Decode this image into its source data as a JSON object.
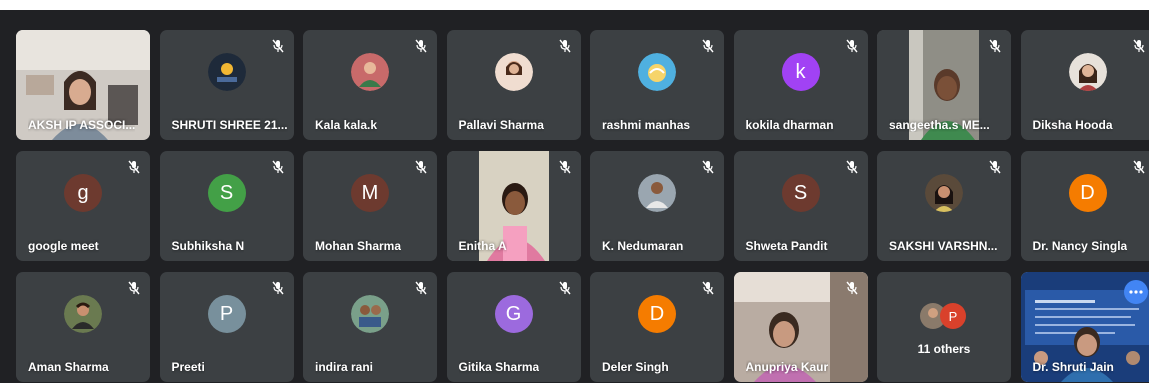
{
  "colors": {
    "tile": "#3c4043",
    "background": "#202124",
    "active_outline": "#8ab4f8"
  },
  "participants": [
    {
      "name": "AKSH IP ASSOCI...",
      "type": "video",
      "muted": false
    },
    {
      "name": "SHRUTI SHREE 21...",
      "type": "photo",
      "muted": true
    },
    {
      "name": "Kala kala.k",
      "type": "photo",
      "muted": true
    },
    {
      "name": "Pallavi Sharma",
      "type": "photo",
      "muted": true
    },
    {
      "name": "rashmi manhas",
      "type": "photo",
      "muted": true
    },
    {
      "name": "kokila dharman",
      "type": "initial",
      "initial": "k",
      "color": "#a142f4",
      "muted": true
    },
    {
      "name": "sangeetha.s ME...",
      "type": "video",
      "muted": true
    },
    {
      "name": "Diksha Hooda",
      "type": "photo",
      "muted": true
    },
    {
      "name": "google meet",
      "type": "initial",
      "initial": "g",
      "color": "#6d3a2f",
      "muted": true
    },
    {
      "name": "Subhiksha N",
      "type": "initial",
      "initial": "S",
      "color": "#43a047",
      "muted": true
    },
    {
      "name": "Mohan Sharma",
      "type": "initial",
      "initial": "M",
      "color": "#6d3a2f",
      "muted": true
    },
    {
      "name": "Enitha A",
      "type": "video",
      "muted": true
    },
    {
      "name": "K. Nedumaran",
      "type": "photo",
      "muted": true
    },
    {
      "name": "Shweta Pandit",
      "type": "initial",
      "initial": "S",
      "color": "#6d3a2f",
      "muted": true
    },
    {
      "name": "SAKSHI VARSHN...",
      "type": "photo",
      "muted": true
    },
    {
      "name": "Dr. Nancy Singla",
      "type": "initial",
      "initial": "D",
      "color": "#f57c00",
      "muted": true
    },
    {
      "name": "Aman Sharma",
      "type": "photo",
      "muted": true
    },
    {
      "name": "Preeti",
      "type": "initial",
      "initial": "P",
      "color": "#78909c",
      "muted": true
    },
    {
      "name": "indira rani",
      "type": "photo",
      "muted": true
    },
    {
      "name": "Gitika Sharma",
      "type": "initial",
      "initial": "G",
      "color": "#9c6ade",
      "muted": true
    },
    {
      "name": "Deler Singh",
      "type": "initial",
      "initial": "D",
      "color": "#f57c00",
      "muted": true
    },
    {
      "name": "Anupriya Kaur",
      "type": "video",
      "muted": true
    },
    {
      "name": "11 others",
      "type": "others",
      "muted": false
    },
    {
      "name": "Dr. Shruti Jain",
      "type": "presenting",
      "muted": false
    }
  ]
}
